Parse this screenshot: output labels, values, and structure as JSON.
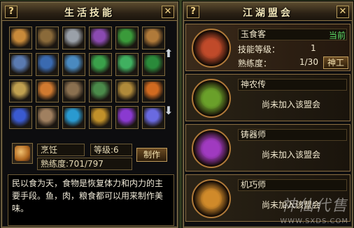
{
  "life_skills": {
    "title": "生活技能",
    "help_label": "?",
    "close_label": "✕",
    "slots": [
      {
        "icon": "roast-chicken-icon",
        "color": "#c88a3a"
      },
      {
        "icon": "bronze-cauldron-icon",
        "color": "#8a6a3a"
      },
      {
        "icon": "ingot-stack-icon",
        "color": "#9aa0a8"
      },
      {
        "icon": "purple-fan-icon",
        "color": "#8a4ab0"
      },
      {
        "icon": "green-leaf-icon",
        "color": "#3a9a3a"
      },
      {
        "icon": "gourd-bottles-icon",
        "color": "#b07a3a"
      },
      {
        "icon": "sword-blade-icon",
        "color": "#5a7ab0"
      },
      {
        "icon": "tower-lantern-icon",
        "color": "#3a6ab0"
      },
      {
        "icon": "spear-polearm-icon",
        "color": "#4a8ac0"
      },
      {
        "icon": "herb-sprout-icon",
        "color": "#3aa04a"
      },
      {
        "icon": "jade-vial-icon",
        "color": "#40b060"
      },
      {
        "icon": "pine-branch-icon",
        "color": "#2a8a3a"
      },
      {
        "icon": "golden-scroll-icon",
        "color": "#c0a050"
      },
      {
        "icon": "fire-bird-icon",
        "color": "#d07a30"
      },
      {
        "icon": "ore-chunk-icon",
        "color": "#8a7050"
      },
      {
        "icon": "green-ledger-icon",
        "color": "#4a8a4a"
      },
      {
        "icon": "amber-jar-icon",
        "color": "#b08a3a"
      },
      {
        "icon": "flame-ring-icon",
        "color": "#d06a20"
      },
      {
        "icon": "blue-shield-icon",
        "color": "#3a5ad0"
      },
      {
        "icon": "warrior-figure-icon",
        "color": "#a08060"
      },
      {
        "icon": "azure-gem-icon",
        "color": "#2a9ad0"
      },
      {
        "icon": "treasure-chest-icon",
        "color": "#c0902a"
      },
      {
        "icon": "violet-orb-icon",
        "color": "#8a3ad0"
      },
      {
        "icon": "crystal-cluster-icon",
        "color": "#6a6ae0"
      }
    ],
    "selected": {
      "icon": "roast-chicken-icon",
      "name": "烹饪",
      "level_label": "等级:6",
      "proficiency_label": "熟练度:701/797",
      "make_button": "制作"
    },
    "description": "民以食为天，食物是恢复体力和内力的主要手段。鱼，肉，粮食都可以用来制作美味。"
  },
  "guild": {
    "title": "江湖盟会",
    "help_label": "?",
    "close_label": "✕",
    "cards": [
      {
        "name": "玉食客",
        "status": "当前",
        "skill_level_label": "技能等级：",
        "skill_level_value": "1",
        "proficiency_label": "熟练度：",
        "proficiency_value": "1/30",
        "button": "神工",
        "emblem_color": "#c04a2a"
      },
      {
        "name": "神农传",
        "message": "尚未加入该盟会",
        "emblem_color": "#6aa02a"
      },
      {
        "name": "铸器师",
        "message": "尚未加入该盟会",
        "emblem_color": "#a03ac0"
      },
      {
        "name": "机巧师",
        "message": "尚未加入该盟会",
        "emblem_color": "#d08a2a"
      }
    ]
  },
  "watermark": {
    "main": "神仙代售",
    "url": "WWW.SXDS.COM"
  }
}
